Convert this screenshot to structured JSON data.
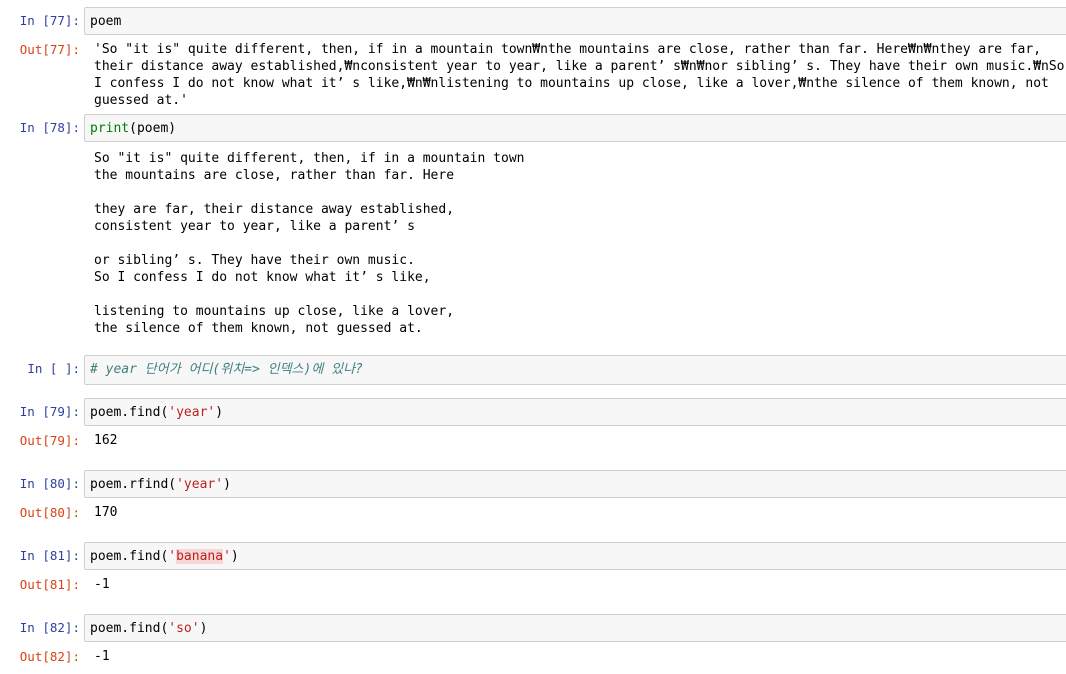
{
  "cells": {
    "c77": {
      "in_prompt": "In [77]:",
      "code": "poem",
      "out_prompt": "Out[77]:",
      "output": "'So \"it is\" quite different, then, if in a mountain town₩nthe mountains are close, rather than far. Here₩n₩nthey are far, their distance away established,₩nconsistent year to year, like a parent’ s₩n₩nor sibling’ s. They have their own music.₩nSo I confess I do not know what it’ s like,₩n₩nlistening to mountains up close, like a lover,₩nthe silence of them known, not guessed at.'"
    },
    "c78": {
      "in_prompt": "In [78]:",
      "code_func": "print",
      "code_rest": "(poem)",
      "output": "So \"it is\" quite different, then, if in a mountain town\nthe mountains are close, rather than far. Here\n\nthey are far, their distance away established,\nconsistent year to year, like a parent’ s\n\nor sibling’ s. They have their own music.\nSo I confess I do not know what it’ s like,\n\nlistening to mountains up close, like a lover,\nthe silence of them known, not guessed at."
    },
    "cEmpty": {
      "in_prompt": "In [ ]:",
      "comment": "# year 단어가 어디(위치=> 인덱스)에 있나?"
    },
    "c79": {
      "in_prompt": "In [79]:",
      "code_pre": "poem.find(",
      "code_str": "'year'",
      "code_post": ")",
      "out_prompt": "Out[79]:",
      "output": "162"
    },
    "c80": {
      "in_prompt": "In [80]:",
      "code_pre": "poem.rfind(",
      "code_str": "'year'",
      "code_post": ")",
      "out_prompt": "Out[80]:",
      "output": "170"
    },
    "c81": {
      "in_prompt": "In [81]:",
      "code_pre": "poem.find(",
      "code_q1": "'",
      "code_str": "banana",
      "code_q2": "'",
      "code_post": ")",
      "out_prompt": "Out[81]:",
      "output": "-1"
    },
    "c82": {
      "in_prompt": "In [82]:",
      "code_pre": "poem.find(",
      "code_str": "'so'",
      "code_post": ")",
      "out_prompt": "Out[82]:",
      "output": "-1"
    }
  }
}
